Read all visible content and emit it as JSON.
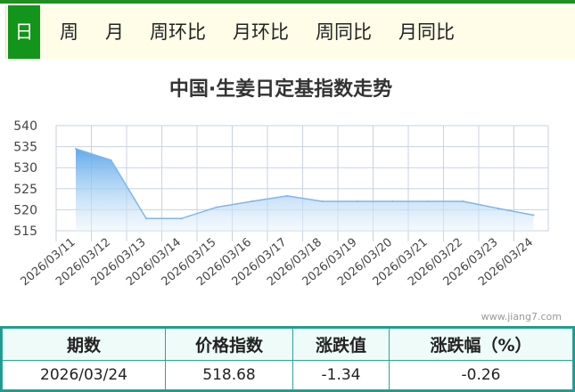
{
  "tabs": [
    {
      "label": "日",
      "active": true
    },
    {
      "label": "周",
      "active": false
    },
    {
      "label": "月",
      "active": false
    },
    {
      "label": "周环比",
      "active": false
    },
    {
      "label": "月环比",
      "active": false
    },
    {
      "label": "周同比",
      "active": false
    },
    {
      "label": "月同比",
      "active": false
    }
  ],
  "watermark": "www.jiang7.com",
  "colors": {
    "accent": "#12951a",
    "line": "#7fb6e8",
    "table_border": "#2aa597",
    "header_bg": "#eefbf8"
  },
  "chart_data": {
    "type": "area",
    "title": "中国·生姜日定基指数走势",
    "xlabel": "",
    "ylabel": "",
    "x": [
      "2026/03/11",
      "2026/03/12",
      "2026/03/13",
      "2026/03/14",
      "2026/03/15",
      "2026/03/16",
      "2026/03/17",
      "2026/03/18",
      "2026/03/19",
      "2026/03/20",
      "2026/03/21",
      "2026/03/22",
      "2026/03/23",
      "2026/03/24"
    ],
    "series": [
      {
        "values": [
          534.5,
          531.8,
          517.9,
          517.9,
          520.6,
          522.0,
          523.3,
          522.0,
          522.0,
          522.0,
          522.0,
          522.0,
          520.3,
          518.7
        ]
      }
    ],
    "ylim": [
      515,
      540
    ],
    "yticks": [
      540,
      535,
      530,
      525,
      520,
      515
    ],
    "grid": true,
    "legend": "none"
  },
  "table": {
    "headers": [
      "期数",
      "价格指数",
      "涨跌值",
      "涨跌幅（%）"
    ],
    "rows": [
      [
        "2026/03/24",
        "518.68",
        "-1.34",
        "-0.26"
      ]
    ]
  }
}
